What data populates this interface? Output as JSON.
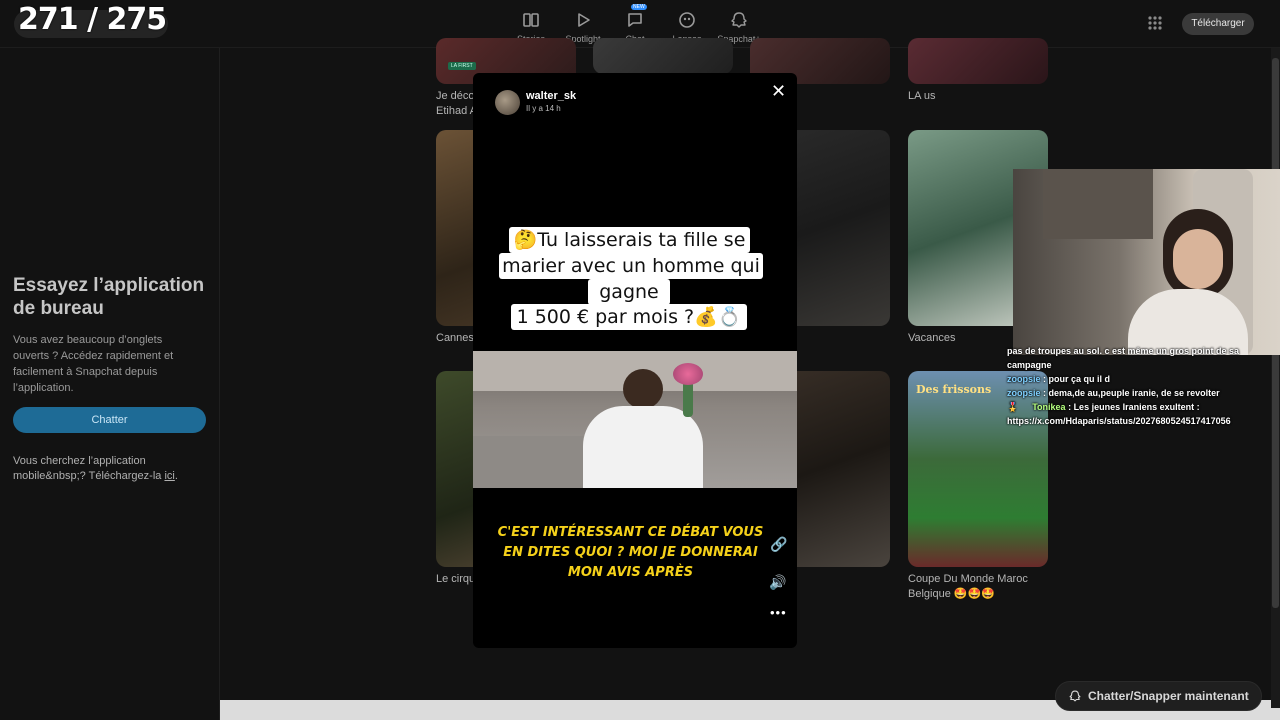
{
  "topbar": {
    "counter": "271 / 275",
    "nav": [
      {
        "label": "Stories",
        "icon": "stories-icon"
      },
      {
        "label": "Spotlight",
        "icon": "play-icon"
      },
      {
        "label": "Chat",
        "icon": "chat-icon",
        "badge": "NEW"
      },
      {
        "label": "Lenses",
        "icon": "lenses-icon"
      },
      {
        "label": "Snapchat+",
        "icon": "ghost-icon"
      }
    ],
    "download_label": "Télécharger"
  },
  "sidebar": {
    "title": "Essayez l’application de bureau",
    "text": "Vous avez beaucoup d’onglets ouverts ? Accédez rapidement et facilement à Snapchat depuis l’application.",
    "chat_button": "Chatter",
    "mobile_text_pre": "Vous cherchez l’application mobile&nbsp;? Téléchargez-la ",
    "mobile_link": "ici",
    "mobile_text_post": "."
  },
  "cards": [
    {
      "label": "Je déco\nEtihad A",
      "badge": "LA FIRST"
    },
    {
      "label": "LA us"
    },
    {
      "label": "Cannes"
    },
    {
      "label": "Vacances"
    },
    {
      "label": "Le cirqu"
    },
    {
      "label": "Coupe Du Monde Maroc Belgique 🤩🤩🤩",
      "banner": "Des frissons"
    }
  ],
  "modal": {
    "username": "walter_sk",
    "time": "Il y a 14 h",
    "question_lines": [
      "🤔Tu laisserais ta fille se",
      "marier avec un homme qui",
      "gagne",
      "1 500 € par mois ?💰💍"
    ],
    "caption": "C'EST INTÉRESSANT CE DÉBAT VOUS EN DITES QUOI ? MOI JE DONNERAI MON AVIS APRÈS"
  },
  "stream_chat": [
    {
      "user": "",
      "text": "pas de troupes au sol. c est même un gros point de sa campagne"
    },
    {
      "user": "zoopsie",
      "text": "pour ça qu il d"
    },
    {
      "user": "zoopsie",
      "text": "dema,de au,peuple iranie, de se revolter"
    },
    {
      "user": "Tonikea",
      "text": "Les jeunes Iraniens exultent :"
    },
    {
      "user": "",
      "text": "https://x.com/Hdaparis/status/2027680524517417056"
    }
  ],
  "snap_now_label": "Chatter/Snapper maintenant",
  "colors": {
    "accent_blue": "#1e6b96",
    "caption_yellow": "#f5d11a",
    "background": "#121212"
  }
}
